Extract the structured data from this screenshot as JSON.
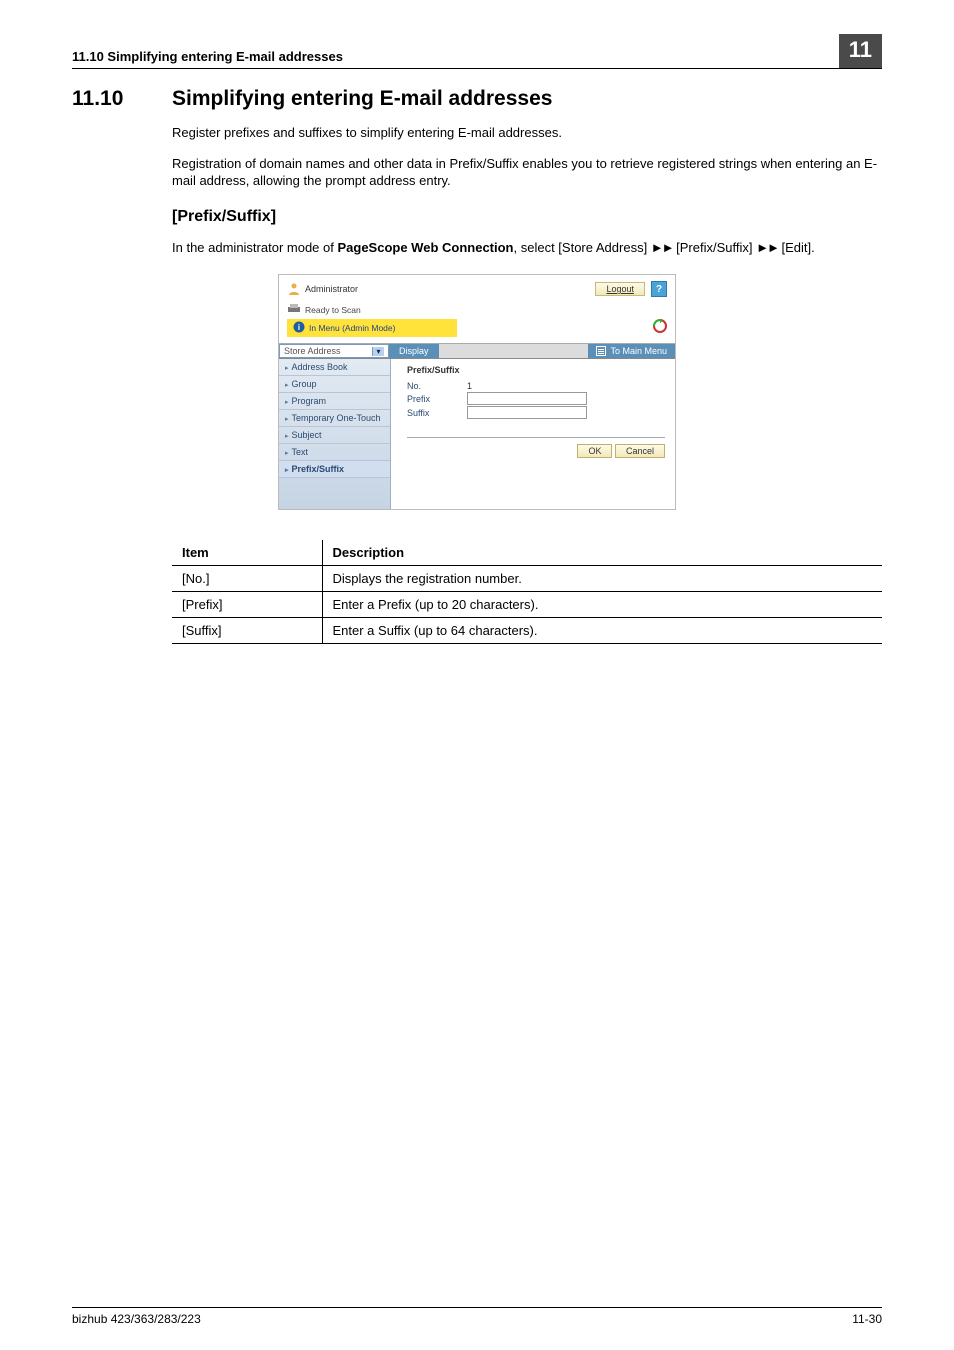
{
  "header": {
    "running_head": "11.10    Simplifying entering E-mail addresses",
    "chapter_badge": "11"
  },
  "section": {
    "number": "11.10",
    "title": "Simplifying entering E-mail addresses"
  },
  "paragraphs": {
    "p1": "Register prefixes and suffixes to simplify entering E-mail addresses.",
    "p2": "Registration of domain names and other data in Prefix/Suffix enables you to retrieve registered strings when entering an E-mail address, allowing the prompt address entry."
  },
  "sub_heading": "[Prefix/Suffix]",
  "instruction": {
    "pre": "In the administrator mode of ",
    "bold": "PageScope Web Connection",
    "post_a": ", select [Store Address] ",
    "post_b": " [Prefix/Suffix] ",
    "post_c": " [Edit]."
  },
  "screenshot": {
    "admin_label": "Administrator",
    "logout": "Logout",
    "help": "?",
    "status_ready": "Ready to Scan",
    "status_menu": "In Menu (Admin Mode)",
    "store_address": "Store Address",
    "display_tab": "Display",
    "to_main": "To Main Menu",
    "sidebar": [
      "Address Book",
      "Group",
      "Program",
      "Temporary One-Touch",
      "Subject",
      "Text",
      "Prefix/Suffix"
    ],
    "form": {
      "title": "Prefix/Suffix",
      "no_label": "No.",
      "no_value": "1",
      "prefix_label": "Prefix",
      "suffix_label": "Suffix"
    },
    "ok": "OK",
    "cancel": "Cancel"
  },
  "table": {
    "head_item": "Item",
    "head_desc": "Description",
    "rows": [
      {
        "item": "[No.]",
        "desc": "Displays the registration number."
      },
      {
        "item": "[Prefix]",
        "desc": "Enter a Prefix (up to 20 characters)."
      },
      {
        "item": "[Suffix]",
        "desc": "Enter a Suffix (up to 64 characters)."
      }
    ]
  },
  "footer": {
    "left": "bizhub 423/363/283/223",
    "right": "11-30"
  }
}
